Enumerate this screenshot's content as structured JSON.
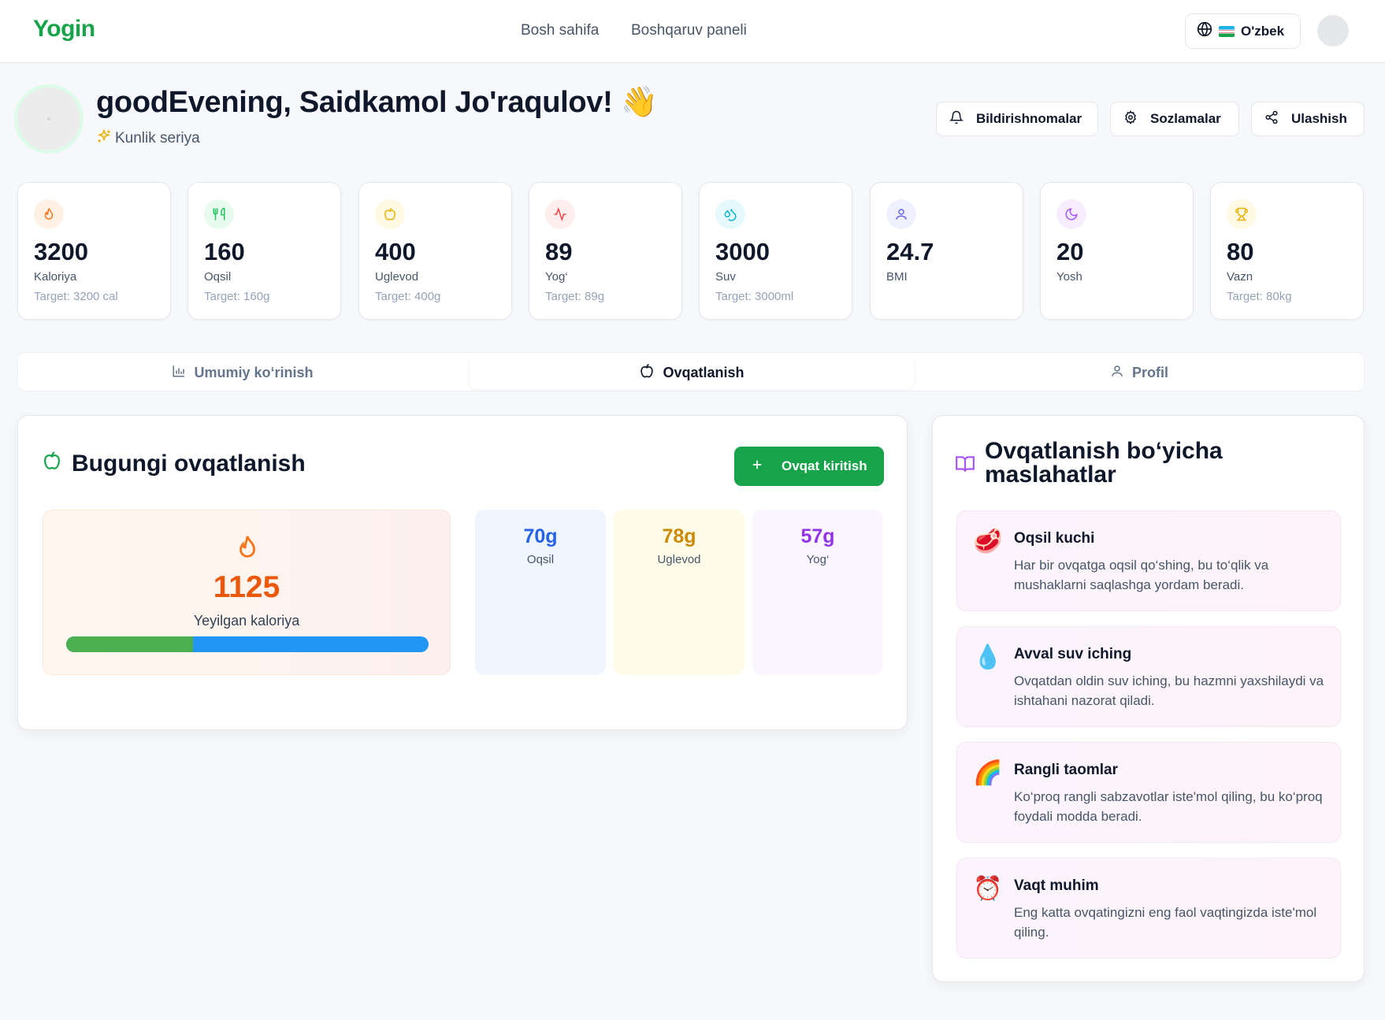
{
  "nav": {
    "logo": "Yogin",
    "links": [
      "Bosh sahifa",
      "Boshqaruv paneli"
    ],
    "language": "O'zbek"
  },
  "greeting": {
    "title": "goodEvening, Saidkamol Jo'raqulov! 👋",
    "streak": "Kunlik seriya"
  },
  "actions": {
    "notifications": "Bildirishnomalar",
    "settings": "Sozlamalar",
    "share": "Ulashish"
  },
  "stats": [
    {
      "icon": "flame-icon",
      "value": "3200",
      "label": "Kaloriya",
      "target": "Target: 3200 cal",
      "color": "#f97316",
      "bg": "#fff1e6"
    },
    {
      "icon": "utensils-icon",
      "value": "160",
      "label": "Oqsil",
      "target": "Target: 160g",
      "color": "#22c55e",
      "bg": "#e9fbef"
    },
    {
      "icon": "apple-icon",
      "value": "400",
      "label": "Uglevod",
      "target": "Target: 400g",
      "color": "#eab308",
      "bg": "#fef9e3"
    },
    {
      "icon": "activity-icon",
      "value": "89",
      "label": "Yog‘",
      "target": "Target: 89g",
      "color": "#ef4444",
      "bg": "#feeeee"
    },
    {
      "icon": "droplets-icon",
      "value": "3000",
      "label": "Suv",
      "target": "Target: 3000ml",
      "color": "#06b6d4",
      "bg": "#e6f9fc"
    },
    {
      "icon": "user-icon",
      "value": "24.7",
      "label": "BMI",
      "target": "",
      "color": "#6366f1",
      "bg": "#eef0fd"
    },
    {
      "icon": "moon-icon",
      "value": "20",
      "label": "Yosh",
      "target": "",
      "color": "#a855f7",
      "bg": "#f6eefe"
    },
    {
      "icon": "trophy-icon",
      "value": "80",
      "label": "Vazn",
      "target": "Target: 80kg",
      "color": "#eab308",
      "bg": "#fef9e3"
    }
  ],
  "tabs": [
    {
      "label": "Umumiy ko‘rinish",
      "icon": "bar-chart-icon"
    },
    {
      "label": "Ovqatlanish",
      "icon": "apple-icon"
    },
    {
      "label": "Profil",
      "icon": "user-icon"
    }
  ],
  "nutrition": {
    "title": "Bugungi ovqatlanish",
    "add_button": "Ovqat kiritish",
    "calories_value": "1125",
    "calories_label": "Yeyilgan kaloriya",
    "progress_fraction": 0.35,
    "macros": [
      {
        "value": "70g",
        "label": "Oqsil",
        "color": "#2563eb",
        "bg": "#eff6ff"
      },
      {
        "value": "78g",
        "label": "Uglevod",
        "color": "#ca8a04",
        "bg": "#fefce8"
      },
      {
        "value": "57g",
        "label": "Yog‘",
        "color": "#9333ea",
        "bg": "#faf5ff"
      }
    ]
  },
  "tips": {
    "title": "Ovqatlanish bo‘yicha maslahatlar",
    "items": [
      {
        "emoji": "🥩",
        "title": "Oqsil kuchi",
        "text": "Har bir ovqatga oqsil qo‘shing, bu to‘qlik va mushaklarni saqlashga yordam beradi."
      },
      {
        "emoji": "💧",
        "title": "Avval suv iching",
        "text": "Ovqatdan oldin suv iching, bu hazmni yaxshilaydi va ishtahani nazorat qiladi."
      },
      {
        "emoji": "🌈",
        "title": "Rangli taomlar",
        "text": "Ko‘proq rangli sabzavotlar iste'mol qiling, bu ko‘proq foydali modda beradi."
      },
      {
        "emoji": "⏰",
        "title": "Vaqt muhim",
        "text": "Eng katta ovqatingizni eng faol vaqtingizda iste'mol qiling."
      }
    ]
  }
}
